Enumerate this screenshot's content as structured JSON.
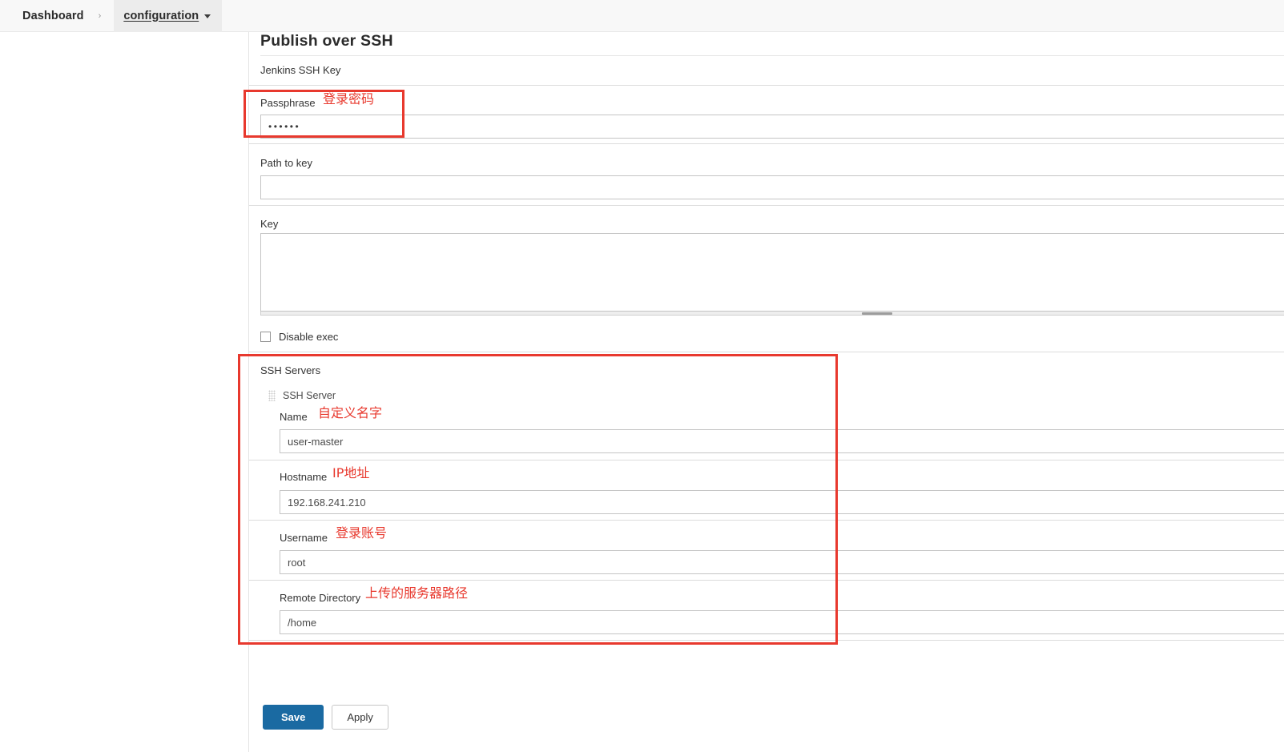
{
  "breadcrumb": {
    "dashboard": "Dashboard",
    "separator": "›",
    "configuration": "configuration"
  },
  "page": {
    "title": "Publish over SSH",
    "jenkins_ssh_key_label": "Jenkins SSH Key"
  },
  "fields": {
    "passphrase": {
      "label": "Passphrase",
      "value": "••••••",
      "placeholder": "",
      "annotation": "登录密码"
    },
    "path_to_key": {
      "label": "Path to key",
      "value": "",
      "placeholder": ""
    },
    "key": {
      "label": "Key",
      "value": "",
      "placeholder": ""
    },
    "disable_exec": {
      "label": "Disable exec",
      "checked": false
    }
  },
  "ssh_servers": {
    "section_label": "SSH Servers",
    "server_entry_title": "SSH Server",
    "drag_handle_icon": "drag-handle-icon",
    "fields": [
      {
        "label": "Name",
        "annotation": "自定义名字",
        "value": "user-master",
        "placeholder": "",
        "name": "name"
      },
      {
        "label": "Hostname",
        "annotation": "IP地址",
        "value": "192.168.241.210",
        "placeholder": "",
        "name": "hostname"
      },
      {
        "label": "Username",
        "annotation": "登录账号",
        "value": "root",
        "placeholder": "",
        "name": "username"
      },
      {
        "label": "Remote Directory",
        "annotation": "上传的服务器路径",
        "value": "/home",
        "placeholder": "",
        "name": "remote-directory"
      }
    ]
  },
  "footer": {
    "save_label": "Save",
    "apply_label": "Apply"
  },
  "colors": {
    "annotation_red": "#e8392e",
    "save_blue": "#1a6aa2",
    "breadcrumb_bg": "#f8f8f8",
    "crumb_active_bg": "#ececec",
    "field_border": "#c4c4c4"
  }
}
